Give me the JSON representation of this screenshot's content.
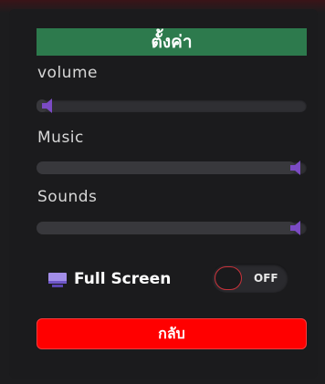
{
  "title": "ตั้งค่า",
  "settings": [
    {
      "key": "volume",
      "label": "volume",
      "level": 0.0
    },
    {
      "key": "music",
      "label": "Music",
      "level": 1.0
    },
    {
      "key": "sounds",
      "label": "Sounds",
      "level": 1.0
    }
  ],
  "fullscreen": {
    "label": "Full Screen",
    "state": "OFF"
  },
  "back_label": "กลับ",
  "colors": {
    "title_bg": "#2d7a4d",
    "thumb": "#7b4bc4",
    "toggle_border": "#c9323a",
    "back_bg": "#ff0000",
    "monitor_screen": "#a38ee8"
  },
  "icons": {
    "slider_thumb": "speaker-icon",
    "fullscreen": "monitor-icon"
  }
}
